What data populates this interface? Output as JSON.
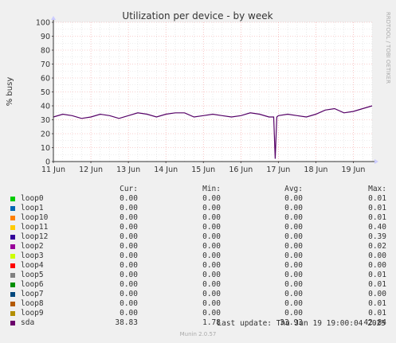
{
  "chart_data": {
    "type": "line",
    "title": "Utilization per device - by week",
    "ylabel": "% busy",
    "side_label": "RRDTOOL / TOBI OETIKER",
    "ylim": [
      0,
      100
    ],
    "yticks": [
      "0",
      "10",
      "20",
      "30",
      "40",
      "50",
      "60",
      "70",
      "80",
      "90",
      "100"
    ],
    "xlim": [
      "2025-06-11",
      "2025-06-19T12:00"
    ],
    "xticks": [
      "11 Jun",
      "12 Jun",
      "13 Jun",
      "14 Jun",
      "15 Jun",
      "16 Jun",
      "17 Jun",
      "18 Jun",
      "19 Jun"
    ],
    "grid": true,
    "series": [
      {
        "name": "sda",
        "color": "#550066",
        "x": [
          "2025-06-11T00:00",
          "2025-06-11T06:00",
          "2025-06-11T12:00",
          "2025-06-11T18:00",
          "2025-06-12T00:00",
          "2025-06-12T06:00",
          "2025-06-12T12:00",
          "2025-06-12T18:00",
          "2025-06-13T00:00",
          "2025-06-13T06:00",
          "2025-06-13T12:00",
          "2025-06-13T18:00",
          "2025-06-14T00:00",
          "2025-06-14T06:00",
          "2025-06-14T12:00",
          "2025-06-14T18:00",
          "2025-06-15T00:00",
          "2025-06-15T06:00",
          "2025-06-15T12:00",
          "2025-06-15T18:00",
          "2025-06-16T00:00",
          "2025-06-16T06:00",
          "2025-06-16T12:00",
          "2025-06-16T18:00",
          "2025-06-16T21:00",
          "2025-06-16T22:00",
          "2025-06-16T23:00",
          "2025-06-17T00:00",
          "2025-06-17T06:00",
          "2025-06-17T12:00",
          "2025-06-17T18:00",
          "2025-06-18T00:00",
          "2025-06-18T06:00",
          "2025-06-18T12:00",
          "2025-06-18T18:00",
          "2025-06-19T00:00",
          "2025-06-19T06:00",
          "2025-06-19T12:00"
        ],
        "values": [
          32,
          34,
          33,
          31,
          32,
          34,
          33,
          31,
          33,
          35,
          34,
          32,
          34,
          35,
          35,
          32,
          33,
          34,
          33,
          32,
          33,
          35,
          34,
          32,
          32,
          2,
          32,
          33,
          34,
          33,
          32,
          34,
          37,
          38,
          35,
          36,
          38,
          40
        ]
      }
    ]
  },
  "legend": {
    "headers": {
      "cur": "Cur:",
      "min": "Min:",
      "avg": "Avg:",
      "max": "Max:"
    },
    "rows": [
      {
        "name": "loop0",
        "color": "#00cc00",
        "cur": "0.00",
        "min": "0.00",
        "avg": "0.00",
        "max": "0.01"
      },
      {
        "name": "loop1",
        "color": "#0066b3",
        "cur": "0.00",
        "min": "0.00",
        "avg": "0.00",
        "max": "0.01"
      },
      {
        "name": "loop10",
        "color": "#ff8000",
        "cur": "0.00",
        "min": "0.00",
        "avg": "0.00",
        "max": "0.01"
      },
      {
        "name": "loop11",
        "color": "#ffcc00",
        "cur": "0.00",
        "min": "0.00",
        "avg": "0.00",
        "max": "0.40"
      },
      {
        "name": "loop12",
        "color": "#330099",
        "cur": "0.00",
        "min": "0.00",
        "avg": "0.00",
        "max": "0.39"
      },
      {
        "name": "loop2",
        "color": "#990099",
        "cur": "0.00",
        "min": "0.00",
        "avg": "0.00",
        "max": "0.02"
      },
      {
        "name": "loop3",
        "color": "#ccff00",
        "cur": "0.00",
        "min": "0.00",
        "avg": "0.00",
        "max": "0.00"
      },
      {
        "name": "loop4",
        "color": "#ff0000",
        "cur": "0.00",
        "min": "0.00",
        "avg": "0.00",
        "max": "0.00"
      },
      {
        "name": "loop5",
        "color": "#808080",
        "cur": "0.00",
        "min": "0.00",
        "avg": "0.00",
        "max": "0.01"
      },
      {
        "name": "loop6",
        "color": "#008f00",
        "cur": "0.00",
        "min": "0.00",
        "avg": "0.00",
        "max": "0.01"
      },
      {
        "name": "loop7",
        "color": "#00487d",
        "cur": "0.00",
        "min": "0.00",
        "avg": "0.00",
        "max": "0.00"
      },
      {
        "name": "loop8",
        "color": "#b35a00",
        "cur": "0.00",
        "min": "0.00",
        "avg": "0.00",
        "max": "0.01"
      },
      {
        "name": "loop9",
        "color": "#b38f00",
        "cur": "0.00",
        "min": "0.00",
        "avg": "0.00",
        "max": "0.01"
      },
      {
        "name": "sda",
        "color": "#6b006b",
        "cur": "38.83",
        "min": "1.78",
        "avg": "33.93",
        "max": "42.84"
      }
    ]
  },
  "footer": {
    "last_update": "Last update: Thu Jun 19 19:00:04 2025",
    "version": "Munin 2.0.57"
  }
}
